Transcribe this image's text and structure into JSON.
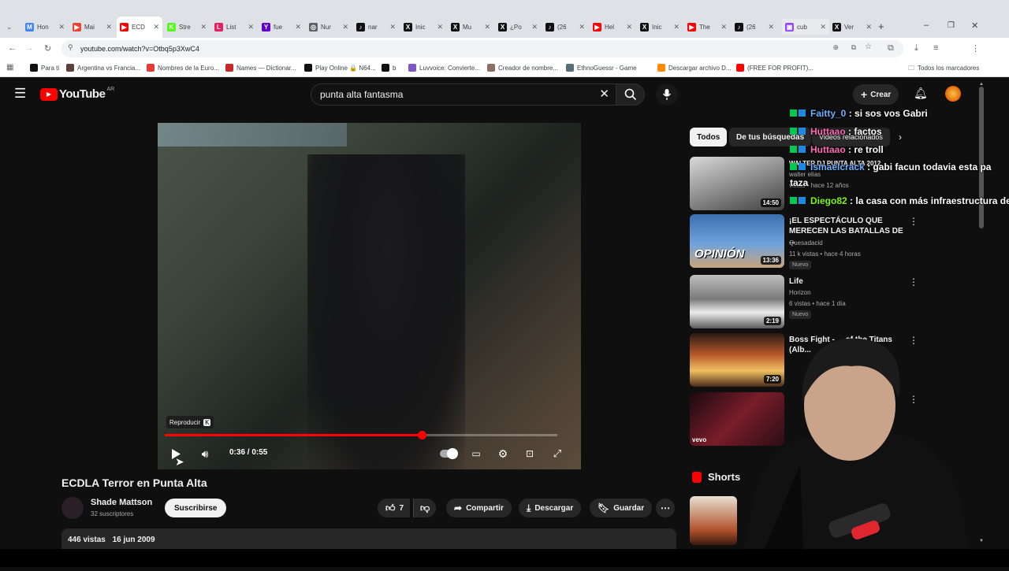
{
  "browser": {
    "tabs": [
      {
        "label": "Hon",
        "color": "#4285f4",
        "glyph": "M"
      },
      {
        "label": "Mai",
        "color": "#ea4335",
        "glyph": "▶"
      },
      {
        "label": "ECD",
        "color": "#ff0000",
        "glyph": "▶"
      },
      {
        "label": "Stre",
        "color": "#53fc18",
        "glyph": "K"
      },
      {
        "label": "List",
        "color": "#e91e63",
        "glyph": "L"
      },
      {
        "label": "fue",
        "color": "#6001d2",
        "glyph": "Y"
      },
      {
        "label": "Nur",
        "color": "#5f6368",
        "glyph": "◎"
      },
      {
        "label": "nar",
        "color": "#111111",
        "glyph": "♪"
      },
      {
        "label": "Inic",
        "color": "#111111",
        "glyph": "X"
      },
      {
        "label": "Mu",
        "color": "#111111",
        "glyph": "X"
      },
      {
        "label": "¿Po",
        "color": "#111111",
        "glyph": "X"
      },
      {
        "label": "(26",
        "color": "#111111",
        "glyph": "♪"
      },
      {
        "label": "Hel",
        "color": "#ff0000",
        "glyph": "▶"
      },
      {
        "label": "Inic",
        "color": "#111111",
        "glyph": "X"
      },
      {
        "label": "The",
        "color": "#ff0000",
        "glyph": "▶"
      },
      {
        "label": "(26",
        "color": "#111111",
        "glyph": "♪"
      },
      {
        "label": "cub",
        "color": "#9146ff",
        "glyph": "▣"
      },
      {
        "label": "Ver",
        "color": "#111111",
        "glyph": "X"
      }
    ],
    "new_tab_glyph": "+",
    "url": "youtube.com/watch?v=Otbq5p3XwC4",
    "bookmarks": [
      {
        "label": "Para ti",
        "color": "#111111"
      },
      {
        "label": "Argentina vs Francia...",
        "color": "#5d4037"
      },
      {
        "label": "Nombres de la Euro...",
        "color": "#e53935"
      },
      {
        "label": "Names — Dictionar...",
        "color": "#c62828"
      },
      {
        "label": "Play Online 🔒 N64...",
        "color": "#111111"
      },
      {
        "label": "b",
        "color": "#111111"
      },
      {
        "label": "Luvvoice: Convierte...",
        "color": "#7e57c2"
      },
      {
        "label": "Creador de nombre...",
        "color": "#8d6e63"
      },
      {
        "label": "EthnoGuessr - Game",
        "color": "#546e7a"
      },
      {
        "label": "Descargar archivo D...",
        "color": "#fb8c00"
      },
      {
        "label": "(FREE FOR PROFIT)...",
        "color": "#ff0000"
      }
    ],
    "all_bookmarks": "Todos los marcadores"
  },
  "youtube": {
    "logo_text": "YouTube",
    "country": "AR",
    "search_query": "punta alta fantasma",
    "create_label": "Crear",
    "player": {
      "tooltip": "Reproducir",
      "tooltip_key": "K",
      "time": "0:36 / 0:55",
      "progress": 0.6545
    },
    "video": {
      "title": "ECDLA Terror en Punta Alta",
      "channel": "Shade Mattson",
      "subscribers": "32 suscriptores",
      "subscribe_label": "Suscribirse",
      "likes": "7",
      "share_label": "Compartir",
      "download_label": "Descargar",
      "save_label": "Guardar",
      "views": "446 vistas",
      "date": "16 jun 2009"
    },
    "chips": [
      "Todos",
      "De tus búsquedas",
      "Videos relacionados"
    ],
    "recommendations": [
      {
        "title": "WALTER DJ PUNTA ALTA 2012",
        "channel": "walter elias",
        "meta": "vistas • hace 12 años",
        "duration": "14:50",
        "badge": ""
      },
      {
        "title": "¡EL ESPECTÁCULO QUE MERECEN LAS BATALLAS DE ...",
        "channel": "Quesadacid",
        "meta": "11 k vistas • hace 4 horas",
        "duration": "13:36",
        "badge": "Nuevo",
        "thumb_text": "OPINIÓN"
      },
      {
        "title": "Life",
        "channel": "Horizon",
        "meta": "6 vistas • hace 1 día",
        "duration": "2:19",
        "badge": "Nuevo"
      },
      {
        "title": "Boss Fight - ... of the Titans (Alb...",
        "channel": "",
        "meta": "",
        "duration": "7:20",
        "badge": ""
      },
      {
        "title": "...l",
        "channel": "",
        "meta": "",
        "duration": "",
        "badge": "",
        "thumb_text": "vevo"
      }
    ],
    "shorts_label": "Shorts"
  },
  "chat": [
    {
      "user": "Faitty_0",
      "color": "#6ab0ff",
      "message": ": si sos vos Gabri"
    },
    {
      "user": "Huttaao",
      "color": "#ff69b4",
      "message": ": factos"
    },
    {
      "user": "Huttaao",
      "color": "#ff69b4",
      "message": ": re troll"
    },
    {
      "user": "Ismaelcrack",
      "color": "#6ab0ff",
      "message": ": gabi facun todavia esta pa"
    },
    {
      "user": "",
      "color": "#ffffff",
      "message": "taza"
    },
    {
      "user": "Diego82",
      "color": "#7cfc00",
      "message": ": la casa con más infraestructura de"
    }
  ]
}
